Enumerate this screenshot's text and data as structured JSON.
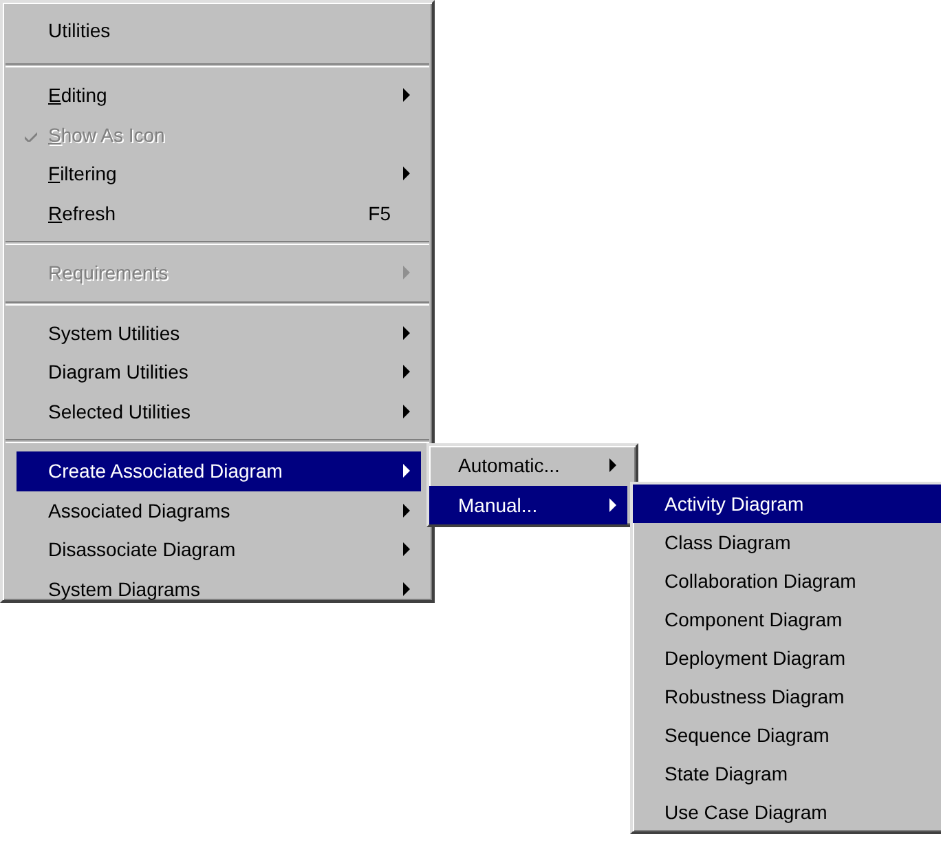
{
  "menu": {
    "items": [
      {
        "kind": "title",
        "label": "Utilities"
      },
      {
        "kind": "separator"
      },
      {
        "kind": "item",
        "label": "Editing",
        "underline_first": true,
        "selected": false,
        "disabled": false,
        "checked": false,
        "has_submenu": true
      },
      {
        "kind": "item",
        "label": "Show As Icon",
        "underline_first": true,
        "selected": false,
        "disabled": true,
        "checked": true,
        "has_submenu": false
      },
      {
        "kind": "item",
        "label": "Filtering",
        "underline_first": true,
        "selected": false,
        "disabled": false,
        "checked": false,
        "has_submenu": true
      },
      {
        "kind": "item",
        "label": "Refresh",
        "underline_first": true,
        "shortcut": "F5",
        "selected": false,
        "disabled": false,
        "checked": false,
        "has_submenu": false
      },
      {
        "kind": "separator"
      },
      {
        "kind": "item",
        "label": "Requirements",
        "underline_first": false,
        "selected": false,
        "disabled": true,
        "checked": false,
        "has_submenu": true
      },
      {
        "kind": "separator"
      },
      {
        "kind": "item",
        "label": "System Utilities",
        "underline_first": false,
        "selected": false,
        "disabled": false,
        "checked": false,
        "has_submenu": true
      },
      {
        "kind": "item",
        "label": "Diagram Utilities",
        "underline_first": false,
        "selected": false,
        "disabled": false,
        "checked": false,
        "has_submenu": true
      },
      {
        "kind": "item",
        "label": "Selected Utilities",
        "underline_first": false,
        "selected": false,
        "disabled": false,
        "checked": false,
        "has_submenu": true
      },
      {
        "kind": "separator"
      },
      {
        "kind": "item",
        "label": "Create Associated Diagram",
        "underline_first": false,
        "selected": true,
        "disabled": false,
        "checked": false,
        "has_submenu": true
      },
      {
        "kind": "item",
        "label": "Associated Diagrams",
        "underline_first": false,
        "selected": false,
        "disabled": false,
        "checked": false,
        "has_submenu": true
      },
      {
        "kind": "item",
        "label": "Disassociate Diagram",
        "underline_first": false,
        "selected": false,
        "disabled": false,
        "checked": false,
        "has_submenu": true
      },
      {
        "kind": "item",
        "label": "System Diagrams",
        "underline_first": false,
        "selected": false,
        "disabled": false,
        "checked": false,
        "has_submenu": true
      }
    ]
  },
  "submenu": {
    "items": [
      {
        "kind": "item",
        "label": "Automatic...",
        "selected": false,
        "has_submenu": true
      },
      {
        "kind": "item",
        "label": "Manual...",
        "selected": true,
        "has_submenu": true
      }
    ]
  },
  "submenu_2": {
    "items": [
      {
        "kind": "item",
        "label": "Activity Diagram",
        "selected": true,
        "has_submenu": false
      },
      {
        "kind": "item",
        "label": "Class Diagram",
        "selected": false,
        "has_submenu": false
      },
      {
        "kind": "item",
        "label": "Collaboration Diagram",
        "selected": false,
        "has_submenu": false
      },
      {
        "kind": "item",
        "label": "Component Diagram",
        "selected": false,
        "has_submenu": false
      },
      {
        "kind": "item",
        "label": "Deployment Diagram",
        "selected": false,
        "has_submenu": false
      },
      {
        "kind": "item",
        "label": "Robustness Diagram",
        "selected": false,
        "has_submenu": false
      },
      {
        "kind": "item",
        "label": "Sequence Diagram",
        "selected": false,
        "has_submenu": false
      },
      {
        "kind": "item",
        "label": "State Diagram",
        "selected": false,
        "has_submenu": false
      },
      {
        "kind": "item",
        "label": "Use Case Diagram",
        "selected": false,
        "has_submenu": false
      }
    ]
  }
}
